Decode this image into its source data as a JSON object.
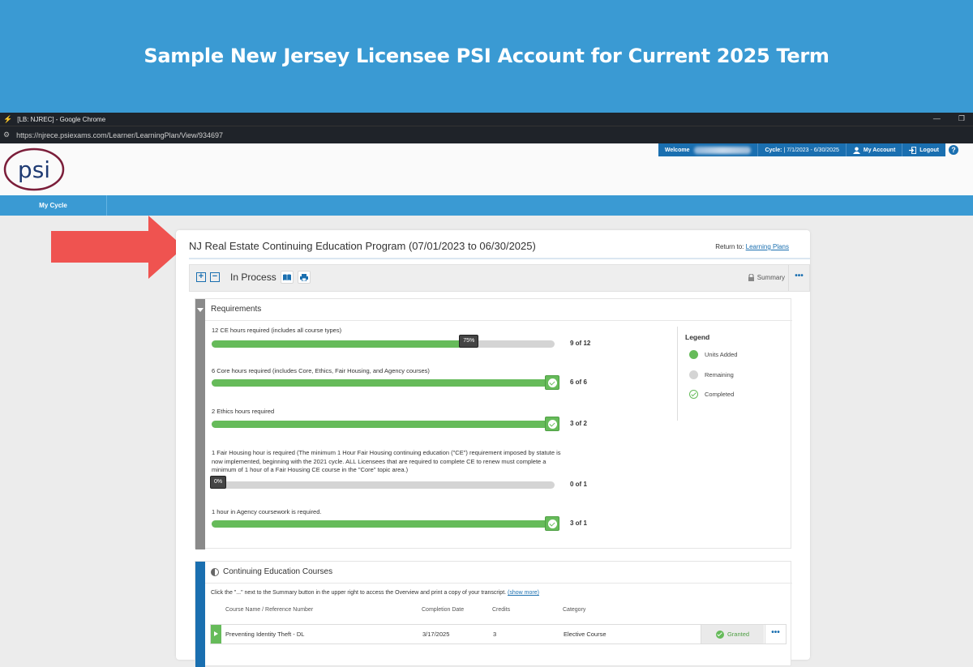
{
  "banner": {
    "title": "Sample New Jersey Licensee PSI Account for Current 2025 Term"
  },
  "browser": {
    "title": "[LB: NJREC] - Google Chrome",
    "url": "https://njrece.psiexams.com/Learner/LearningPlan/View/934697",
    "minimize": "—",
    "restore": "❐"
  },
  "site": {
    "logo_text": "psi",
    "welcome_label": "Welcome",
    "cycle_label": "Cycle:",
    "cycle_value": "| 7/1/2023 - 6/30/2025",
    "my_account": "My Account",
    "logout": "Logout",
    "help": "?",
    "nav_tab": "My Cycle"
  },
  "program": {
    "title": "NJ Real Estate Continuing Education Program (07/01/2023 to 06/30/2025)",
    "return_label": "Return to:",
    "return_link": "Learning Plans",
    "status": "In Process",
    "summary": "Summary",
    "more": "•••"
  },
  "requirements": {
    "heading": "Requirements",
    "items": [
      {
        "label": "12 CE hours required (includes all course types)",
        "progress": 0.75,
        "badge": "75%",
        "count": "9 of 12",
        "complete": false
      },
      {
        "label": "6 Core hours required (includes Core, Ethics, Fair Housing, and Agency courses)",
        "progress": 1.0,
        "count": "6 of 6",
        "complete": true
      },
      {
        "label": "2 Ethics hours required",
        "progress": 1.0,
        "count": "3 of 2",
        "complete": true
      },
      {
        "label": "1 Fair Housing hour is required (The minimum 1 Hour Fair Housing continuing education (\"CE\") requirement imposed by statute is now implemented, beginning with the 2021 cycle. ALL Licensees that are required to complete CE to renew must complete a minimum of 1 hour of a Fair Housing CE course in the \"Core\" topic area.)",
        "progress": 0.0,
        "badge": "0%",
        "count": "0 of 1",
        "complete": false
      },
      {
        "label": "1 hour in Agency coursework is required.",
        "progress": 1.0,
        "count": "3 of 1",
        "complete": true
      }
    ],
    "legend": {
      "title": "Legend",
      "items": [
        {
          "label": "Units Added",
          "color": "#66bb5a"
        },
        {
          "label": "Remaining",
          "color": "#d4d4d4"
        },
        {
          "label": "Completed",
          "color": "#66bb5a"
        }
      ]
    }
  },
  "courses": {
    "heading": "Continuing Education Courses",
    "note": "Click the \"...\" next to the Summary button in the upper right to access the Overview and print a copy of your transcript.",
    "show_more": "(show more)",
    "columns": [
      "Course Name / Reference Number",
      "Completion Date",
      "Credits",
      "Category"
    ],
    "rows": [
      {
        "name": "Preventing Identity Theft - DL",
        "date": "3/17/2025",
        "credits": "3",
        "category": "Elective Course",
        "status": "Granted",
        "more": "•••"
      }
    ]
  },
  "colors": {
    "accent": "#1a6fb0",
    "banner": "#3a9ad3",
    "progress": "#66bb5a",
    "arrow": "#ef5350"
  }
}
